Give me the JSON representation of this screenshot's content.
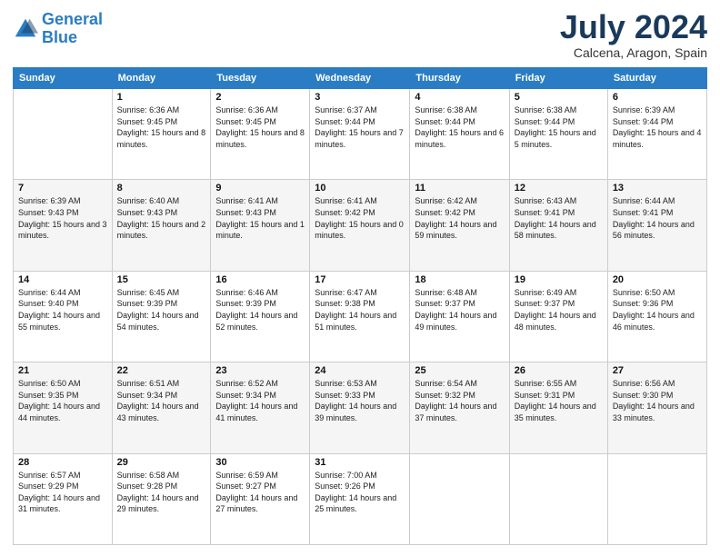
{
  "logo": {
    "line1": "General",
    "line2": "Blue"
  },
  "title": "July 2024",
  "location": "Calcena, Aragon, Spain",
  "days_of_week": [
    "Sunday",
    "Monday",
    "Tuesday",
    "Wednesday",
    "Thursday",
    "Friday",
    "Saturday"
  ],
  "weeks": [
    [
      {
        "day": "",
        "sunrise": "",
        "sunset": "",
        "daylight": ""
      },
      {
        "day": "1",
        "sunrise": "Sunrise: 6:36 AM",
        "sunset": "Sunset: 9:45 PM",
        "daylight": "Daylight: 15 hours and 8 minutes."
      },
      {
        "day": "2",
        "sunrise": "Sunrise: 6:36 AM",
        "sunset": "Sunset: 9:45 PM",
        "daylight": "Daylight: 15 hours and 8 minutes."
      },
      {
        "day": "3",
        "sunrise": "Sunrise: 6:37 AM",
        "sunset": "Sunset: 9:44 PM",
        "daylight": "Daylight: 15 hours and 7 minutes."
      },
      {
        "day": "4",
        "sunrise": "Sunrise: 6:38 AM",
        "sunset": "Sunset: 9:44 PM",
        "daylight": "Daylight: 15 hours and 6 minutes."
      },
      {
        "day": "5",
        "sunrise": "Sunrise: 6:38 AM",
        "sunset": "Sunset: 9:44 PM",
        "daylight": "Daylight: 15 hours and 5 minutes."
      },
      {
        "day": "6",
        "sunrise": "Sunrise: 6:39 AM",
        "sunset": "Sunset: 9:44 PM",
        "daylight": "Daylight: 15 hours and 4 minutes."
      }
    ],
    [
      {
        "day": "7",
        "sunrise": "Sunrise: 6:39 AM",
        "sunset": "Sunset: 9:43 PM",
        "daylight": "Daylight: 15 hours and 3 minutes."
      },
      {
        "day": "8",
        "sunrise": "Sunrise: 6:40 AM",
        "sunset": "Sunset: 9:43 PM",
        "daylight": "Daylight: 15 hours and 2 minutes."
      },
      {
        "day": "9",
        "sunrise": "Sunrise: 6:41 AM",
        "sunset": "Sunset: 9:43 PM",
        "daylight": "Daylight: 15 hours and 1 minute."
      },
      {
        "day": "10",
        "sunrise": "Sunrise: 6:41 AM",
        "sunset": "Sunset: 9:42 PM",
        "daylight": "Daylight: 15 hours and 0 minutes."
      },
      {
        "day": "11",
        "sunrise": "Sunrise: 6:42 AM",
        "sunset": "Sunset: 9:42 PM",
        "daylight": "Daylight: 14 hours and 59 minutes."
      },
      {
        "day": "12",
        "sunrise": "Sunrise: 6:43 AM",
        "sunset": "Sunset: 9:41 PM",
        "daylight": "Daylight: 14 hours and 58 minutes."
      },
      {
        "day": "13",
        "sunrise": "Sunrise: 6:44 AM",
        "sunset": "Sunset: 9:41 PM",
        "daylight": "Daylight: 14 hours and 56 minutes."
      }
    ],
    [
      {
        "day": "14",
        "sunrise": "Sunrise: 6:44 AM",
        "sunset": "Sunset: 9:40 PM",
        "daylight": "Daylight: 14 hours and 55 minutes."
      },
      {
        "day": "15",
        "sunrise": "Sunrise: 6:45 AM",
        "sunset": "Sunset: 9:39 PM",
        "daylight": "Daylight: 14 hours and 54 minutes."
      },
      {
        "day": "16",
        "sunrise": "Sunrise: 6:46 AM",
        "sunset": "Sunset: 9:39 PM",
        "daylight": "Daylight: 14 hours and 52 minutes."
      },
      {
        "day": "17",
        "sunrise": "Sunrise: 6:47 AM",
        "sunset": "Sunset: 9:38 PM",
        "daylight": "Daylight: 14 hours and 51 minutes."
      },
      {
        "day": "18",
        "sunrise": "Sunrise: 6:48 AM",
        "sunset": "Sunset: 9:37 PM",
        "daylight": "Daylight: 14 hours and 49 minutes."
      },
      {
        "day": "19",
        "sunrise": "Sunrise: 6:49 AM",
        "sunset": "Sunset: 9:37 PM",
        "daylight": "Daylight: 14 hours and 48 minutes."
      },
      {
        "day": "20",
        "sunrise": "Sunrise: 6:50 AM",
        "sunset": "Sunset: 9:36 PM",
        "daylight": "Daylight: 14 hours and 46 minutes."
      }
    ],
    [
      {
        "day": "21",
        "sunrise": "Sunrise: 6:50 AM",
        "sunset": "Sunset: 9:35 PM",
        "daylight": "Daylight: 14 hours and 44 minutes."
      },
      {
        "day": "22",
        "sunrise": "Sunrise: 6:51 AM",
        "sunset": "Sunset: 9:34 PM",
        "daylight": "Daylight: 14 hours and 43 minutes."
      },
      {
        "day": "23",
        "sunrise": "Sunrise: 6:52 AM",
        "sunset": "Sunset: 9:34 PM",
        "daylight": "Daylight: 14 hours and 41 minutes."
      },
      {
        "day": "24",
        "sunrise": "Sunrise: 6:53 AM",
        "sunset": "Sunset: 9:33 PM",
        "daylight": "Daylight: 14 hours and 39 minutes."
      },
      {
        "day": "25",
        "sunrise": "Sunrise: 6:54 AM",
        "sunset": "Sunset: 9:32 PM",
        "daylight": "Daylight: 14 hours and 37 minutes."
      },
      {
        "day": "26",
        "sunrise": "Sunrise: 6:55 AM",
        "sunset": "Sunset: 9:31 PM",
        "daylight": "Daylight: 14 hours and 35 minutes."
      },
      {
        "day": "27",
        "sunrise": "Sunrise: 6:56 AM",
        "sunset": "Sunset: 9:30 PM",
        "daylight": "Daylight: 14 hours and 33 minutes."
      }
    ],
    [
      {
        "day": "28",
        "sunrise": "Sunrise: 6:57 AM",
        "sunset": "Sunset: 9:29 PM",
        "daylight": "Daylight: 14 hours and 31 minutes."
      },
      {
        "day": "29",
        "sunrise": "Sunrise: 6:58 AM",
        "sunset": "Sunset: 9:28 PM",
        "daylight": "Daylight: 14 hours and 29 minutes."
      },
      {
        "day": "30",
        "sunrise": "Sunrise: 6:59 AM",
        "sunset": "Sunset: 9:27 PM",
        "daylight": "Daylight: 14 hours and 27 minutes."
      },
      {
        "day": "31",
        "sunrise": "Sunrise: 7:00 AM",
        "sunset": "Sunset: 9:26 PM",
        "daylight": "Daylight: 14 hours and 25 minutes."
      },
      {
        "day": "",
        "sunrise": "",
        "sunset": "",
        "daylight": ""
      },
      {
        "day": "",
        "sunrise": "",
        "sunset": "",
        "daylight": ""
      },
      {
        "day": "",
        "sunrise": "",
        "sunset": "",
        "daylight": ""
      }
    ]
  ]
}
